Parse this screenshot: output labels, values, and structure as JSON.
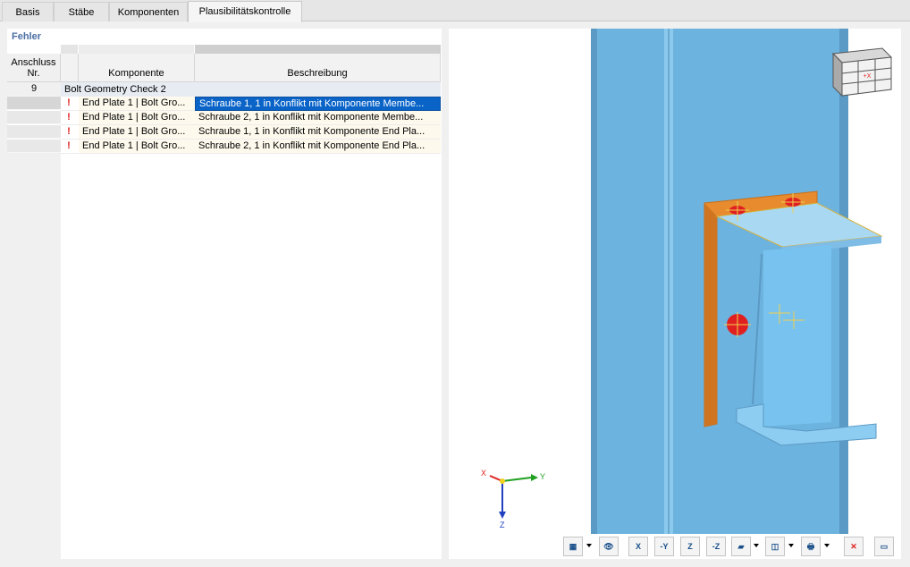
{
  "tabs": [
    {
      "label": "Basis",
      "active": false
    },
    {
      "label": "Stäbe",
      "active": false
    },
    {
      "label": "Komponenten",
      "active": false
    },
    {
      "label": "Plausibilitätskontrolle",
      "active": true
    }
  ],
  "errors_panel": {
    "title": "Fehler",
    "columns": {
      "anschluss": "Anschluss\nNr.",
      "komponente": "Komponente",
      "beschreibung": "Beschreibung"
    },
    "group": {
      "nr": "9",
      "name": "Bolt Geometry Check 2"
    },
    "rows": [
      {
        "komponente": "End Plate 1 | Bolt Gro...",
        "beschreibung": "Schraube 1, 1 in Konflikt mit Komponente Membe...",
        "selected": true
      },
      {
        "komponente": "End Plate 1 | Bolt Gro...",
        "beschreibung": "Schraube 2, 1 in Konflikt mit Komponente Membe...",
        "selected": false
      },
      {
        "komponente": "End Plate 1 | Bolt Gro...",
        "beschreibung": "Schraube 1, 1 in Konflikt mit Komponente End Pla...",
        "selected": false
      },
      {
        "komponente": "End Plate 1 | Bolt Gro...",
        "beschreibung": "Schraube 2, 1 in Konflikt mit Komponente End Pla...",
        "selected": false
      }
    ]
  },
  "view3d": {
    "axes": {
      "x": "X",
      "y": "Y",
      "z": "Z"
    },
    "colors": {
      "member": "#6fb6e0",
      "end_plate": "#e88b2e",
      "bolt_conflict": "#e02020",
      "axis_x": "#e02020",
      "axis_y": "#20a020",
      "axis_z": "#2040c0"
    }
  },
  "toolbar": {
    "buttons": [
      "display-options",
      "visibility",
      "view-x",
      "view-neg-y",
      "view-z",
      "view-neg-z",
      "section",
      "render-mode",
      "print",
      "reset-zoom",
      "export"
    ],
    "labels": {
      "view_x": "X",
      "view_neg_y": "-Y",
      "view_z": "Z",
      "view_neg_z": "-Z"
    }
  }
}
